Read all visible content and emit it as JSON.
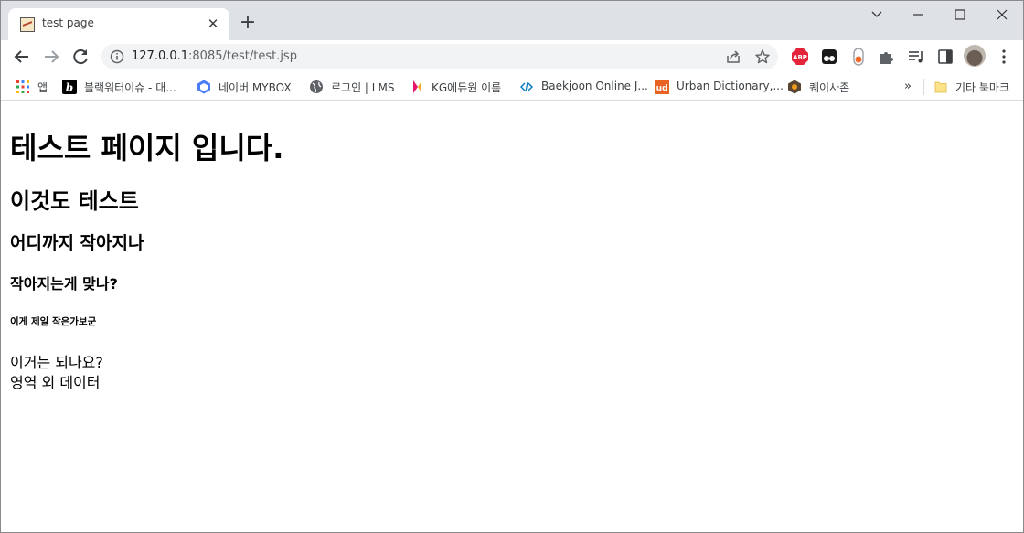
{
  "browser": {
    "tab": {
      "title": "test page"
    },
    "address_bar": {
      "url_host": "127.0.0.1",
      "url_rest": ":8085/test/test.jsp"
    },
    "bookmarks": [
      {
        "label": "앱",
        "icon": "apps-grid-icon"
      },
      {
        "label": "블랙워터이슈 - 대...",
        "icon": "blog-b-icon"
      },
      {
        "label": "네이버 MYBOX",
        "icon": "mybox-icon"
      },
      {
        "label": "로그인 | LMS",
        "icon": "globe-icon"
      },
      {
        "label": "KG에듀원 이룸",
        "icon": "kg-icon"
      },
      {
        "label": "Baekjoon Online J...",
        "icon": "baekjoon-icon"
      },
      {
        "label": "Urban Dictionary,...",
        "icon": "urban-dictionary-icon"
      },
      {
        "label": "퀘이사존",
        "icon": "quasarzone-icon"
      },
      {
        "label": "기타 북마크",
        "icon": "folder-icon"
      }
    ],
    "extensions": {
      "abp_label": "ABP"
    }
  },
  "page": {
    "h1": "테스트 페이지 입니다.",
    "h2": "이것도 테스트",
    "h3": "어디까지 작아지나",
    "h4": "작아지는게 맞나?",
    "h6": "이게 제일 작은가보군",
    "line1": "이거는 되나요?",
    "line2": "영역 외 데이터"
  }
}
